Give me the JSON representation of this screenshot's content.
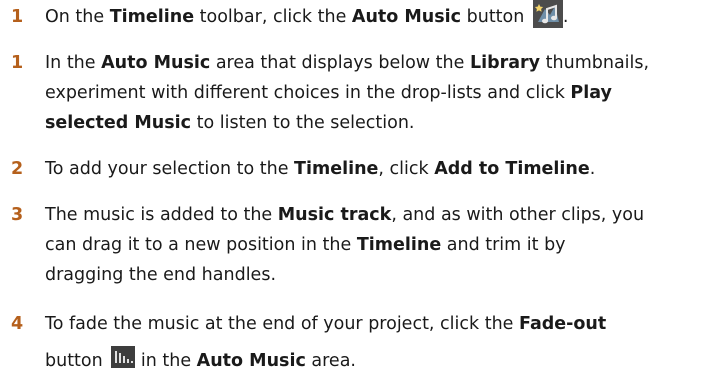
{
  "steps": [
    {
      "number": "1",
      "parts": {
        "t1": "On the ",
        "b1": "Timeline",
        "t2": " toolbar, click the ",
        "b2": "Auto Music",
        "t3": " button ",
        "t4": "."
      },
      "icon": "auto-music-icon"
    },
    {
      "number": "1",
      "parts": {
        "t1": "In the ",
        "b1": "Auto Music",
        "t2": " area that displays below the ",
        "b2": "Library",
        "t3": " thumbnails,",
        "t4": "experiment with different choices in the drop-lists and click ",
        "b3": "Play",
        "b4": "selected Music",
        "t5": " to listen to the selection."
      }
    },
    {
      "number": "2",
      "parts": {
        "t1": "To add your selection to the ",
        "b1": "Timeline",
        "t2": ", click ",
        "b2": "Add to Timeline",
        "t3": "."
      }
    },
    {
      "number": "3",
      "parts": {
        "t1": "The music is added to the ",
        "b1": "Music track",
        "t2": ", and as with other clips, you",
        "t3": "can drag it to a new position in the ",
        "b2": "Timeline",
        "t4": " and trim it by",
        "t5": "dragging the end handles."
      }
    },
    {
      "number": "4",
      "parts": {
        "t1": "To fade the music at the end of your project, click the ",
        "b1": "Fade-out",
        "t2": "button ",
        "t3": " in the ",
        "b2": "Auto Music",
        "t4": " area."
      },
      "icon": "fade-out-icon"
    }
  ],
  "colors": {
    "number": "#b5601c",
    "text": "#1a1a1a"
  }
}
